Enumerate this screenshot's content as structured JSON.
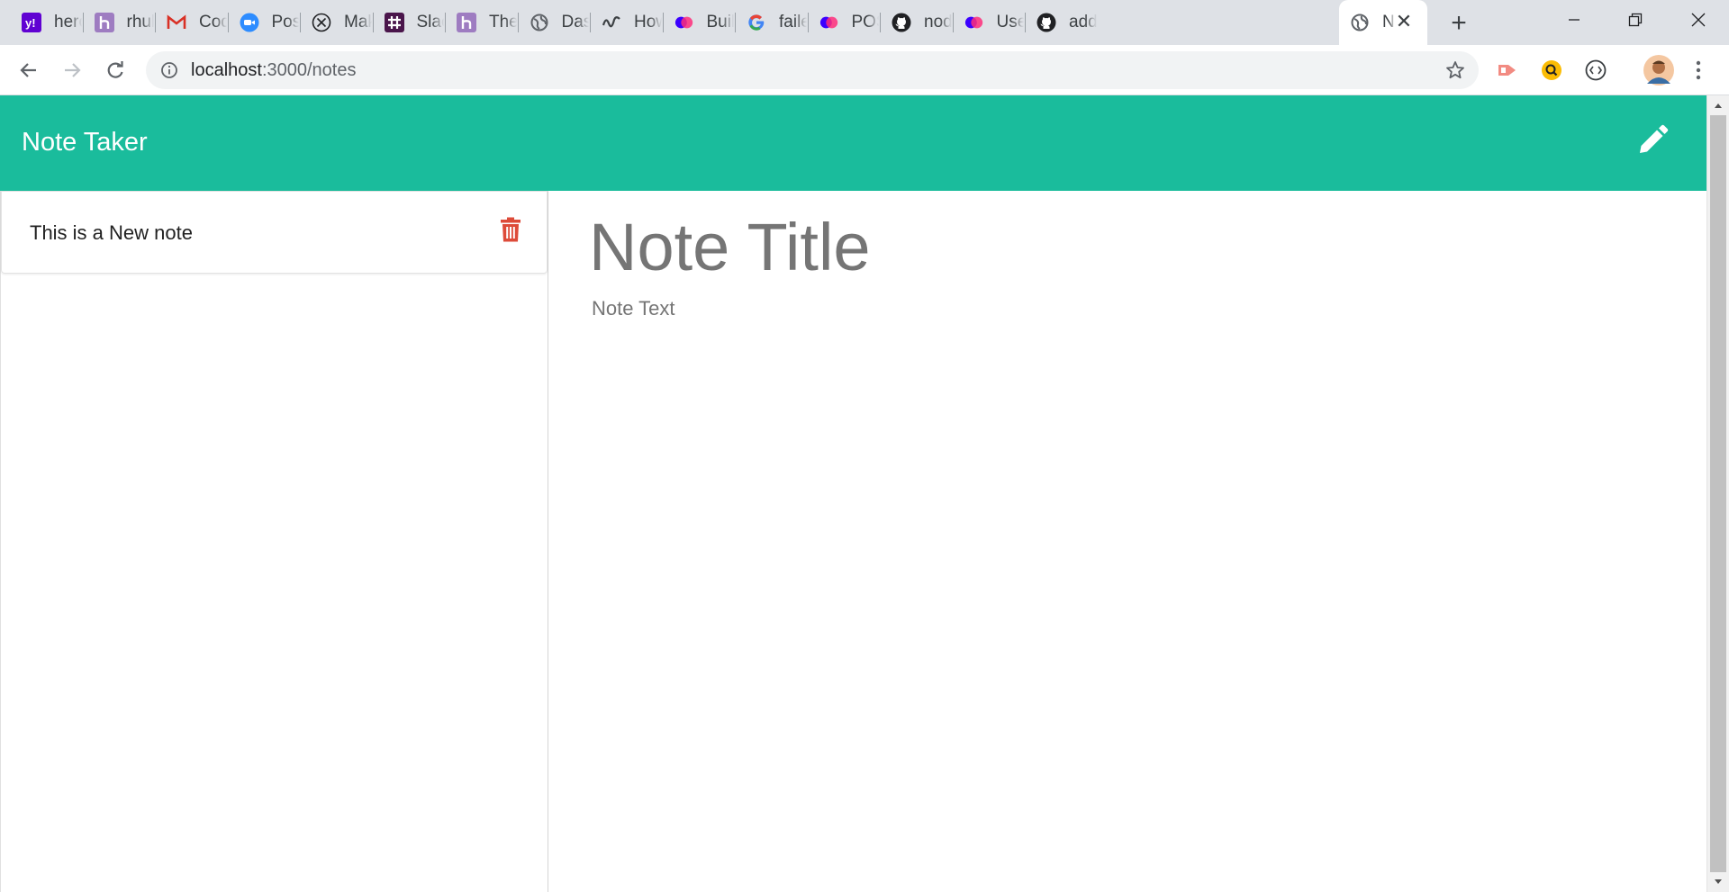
{
  "browser": {
    "tabs": [
      {
        "label": "herol",
        "icon": "yahoo-icon",
        "color": "#6001d2"
      },
      {
        "label": "rhub",
        "icon": "heroku-icon",
        "color": "#9e7cc1"
      },
      {
        "label": "Codi",
        "icon": "gmail-icon",
        "color": "#d93025"
      },
      {
        "label": "Post",
        "icon": "zoom-icon",
        "color": "#2d8cff"
      },
      {
        "label": "Maki",
        "icon": "x-circle-icon",
        "color": "#202124"
      },
      {
        "label": "Slack",
        "icon": "slack-icon",
        "color": "#4a154b"
      },
      {
        "label": "The I",
        "icon": "heroku-icon",
        "color": "#9e7cc1"
      },
      {
        "label": "Dash",
        "icon": "globe-icon",
        "color": "#5f6368"
      },
      {
        "label": "How",
        "icon": "wave-icon",
        "color": "#3c4043"
      },
      {
        "label": "Build",
        "icon": "postman-icon",
        "color": "#3b00ff"
      },
      {
        "label": "failed",
        "icon": "google-icon",
        "color": "#4285f4"
      },
      {
        "label": "POST",
        "icon": "postman-icon",
        "color": "#3b00ff"
      },
      {
        "label": "node",
        "icon": "github-icon",
        "color": "#202124"
      },
      {
        "label": "Use I",
        "icon": "postman-icon",
        "color": "#3b00ff"
      },
      {
        "label": "adde",
        "icon": "github-icon",
        "color": "#202124"
      }
    ],
    "active_tab": {
      "label": "N",
      "icon": "globe-icon"
    },
    "address": {
      "host": "localhost",
      "path": ":3000/notes"
    }
  },
  "app": {
    "title": "Note Taker",
    "accent_color": "#1abc9c",
    "notes": [
      {
        "title": "This is a New note"
      }
    ],
    "editor": {
      "title_placeholder": "Note Title",
      "text_placeholder": "Note Text"
    },
    "delete_color": "#dd4b39"
  }
}
